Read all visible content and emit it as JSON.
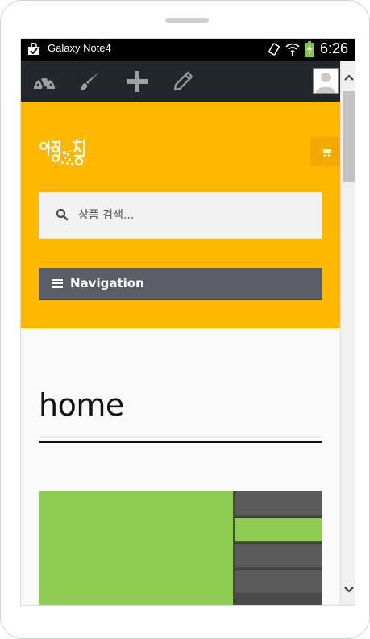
{
  "device": {
    "name": "Galaxy Note4",
    "time": "6:26"
  },
  "toolbar": {
    "icons": [
      "dashboard-icon",
      "brush-icon",
      "plus-icon",
      "pencil-icon",
      "user-avatar-icon"
    ]
  },
  "header": {
    "logo_text": "여행 직행",
    "search": {
      "placeholder": "상품 검색..."
    },
    "navigation_label": "Navigation"
  },
  "main": {
    "title": "home"
  },
  "colors": {
    "accent": "#ffb800",
    "toolbar": "#22272b",
    "nav": "#5b5d66",
    "hero_green": "#8dcc51",
    "hero_dark": "#4a4a4a"
  }
}
